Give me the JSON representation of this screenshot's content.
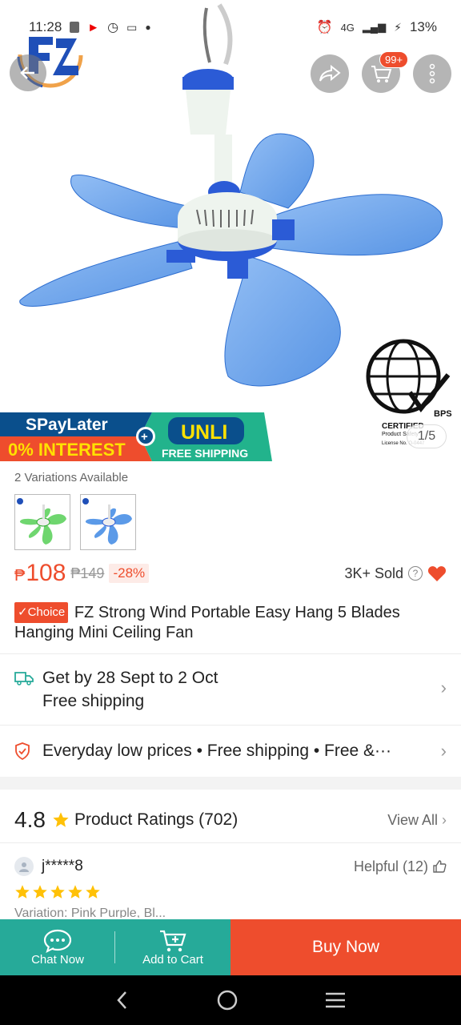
{
  "status_bar": {
    "time": "11:28",
    "battery": "13%",
    "network": "4G"
  },
  "product_image": {
    "counter": "1/5",
    "cart_badge": "99+"
  },
  "certificate": {
    "title": "CERTIFIED",
    "brand": "BPS",
    "line1": "Product Safety",
    "line2": "License No. Q-0447"
  },
  "promo": {
    "spaylater": "SPayLater",
    "interest": "0% INTEREST",
    "unli": "UNLI",
    "free_shipping": "FREE SHIPPING"
  },
  "variations": {
    "label": "2 Variations Available"
  },
  "price": {
    "currency": "₱",
    "current": "108",
    "original": "₱149",
    "discount": "-28%"
  },
  "sold": {
    "label": "3K+ Sold"
  },
  "title": {
    "badge": "✓Choice",
    "text": "FZ Strong Wind Portable Easy Hang 5 Blades Hanging Mini Ceiling Fan"
  },
  "shipping": {
    "date": "Get by 28 Sept to 2 Oct",
    "fee": "Free shipping"
  },
  "guarantee": {
    "text": "Everyday low prices  •  Free shipping  •  Free &···"
  },
  "ratings": {
    "score": "4.8",
    "title": "Product Ratings (702)",
    "view_all": "View All"
  },
  "review": {
    "user": "j*****8",
    "helpful": "Helpful (12)",
    "variation_peek": "Variation: Pink Purple, Bl..."
  },
  "bottom_bar": {
    "chat": "Chat Now",
    "add_cart": "Add to Cart",
    "buy_now": "Buy Now"
  },
  "colors": {
    "brand": "#ee4d2d",
    "teal": "#26aa99",
    "fan_blue": "#4a8fe7",
    "star": "#ffc107"
  }
}
